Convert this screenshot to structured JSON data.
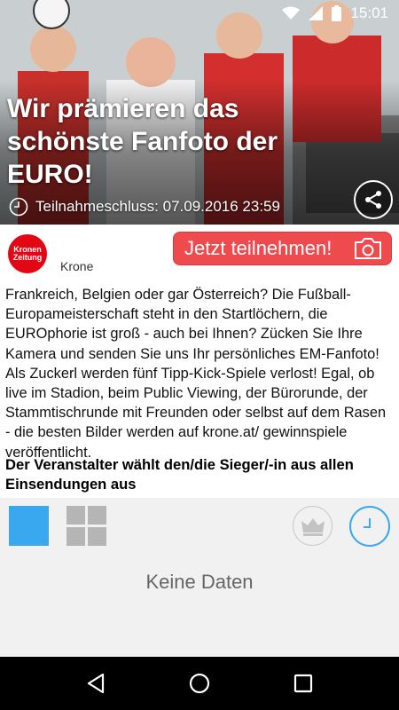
{
  "status_bar": {
    "time": "15:01",
    "icons": [
      "wifi-icon",
      "signal-icon",
      "battery-icon"
    ]
  },
  "hero": {
    "title": "Wir prämieren das schönste Fanfoto der EURO!",
    "deadline": "Teilnahmeschluss: 07.09.2016 23:59",
    "deadline_icon": "clock-icon",
    "share_icon": "share-icon"
  },
  "publisher": {
    "logo_line1": "Kronen",
    "logo_line2": "Zeitung",
    "name": "Krone"
  },
  "participate_button": {
    "label": "Jetzt teilnehmen!",
    "icon": "camera-icon",
    "color": "#ef4a4d"
  },
  "description": "Frankreich, Belgien oder gar Österreich? Die Fußball-Europameisterschaft steht in den Startlöchern, die EUROphorie ist groß - auch bei Ihnen? Zücken Sie Ihre Kamera und senden Sie uns Ihr persönliches EM-Fanfoto! Als Zuckerl werden fünf Tipp-Kick-Spiele verlost! Egal, ob live im Stadion, beim Public Viewing, der Bürorunde, der Stammtischrunde mit Freunden oder selbst auf dem Rasen - die besten Bilder werden auf krone.at/ gewinnspiele veröffentlicht.",
  "rules": "Der Veranstalter wählt den/die Sieger/-in aus allen Einsendungen aus",
  "gallery": {
    "views": [
      "single-view-icon",
      "grid-view-icon"
    ],
    "sort": [
      "crown-icon",
      "clock-icon"
    ],
    "accent_color": "#3aa8ee",
    "empty_text": "Keine Daten"
  },
  "nav_bar": {
    "buttons": [
      "back-icon",
      "home-icon",
      "recents-icon"
    ]
  }
}
